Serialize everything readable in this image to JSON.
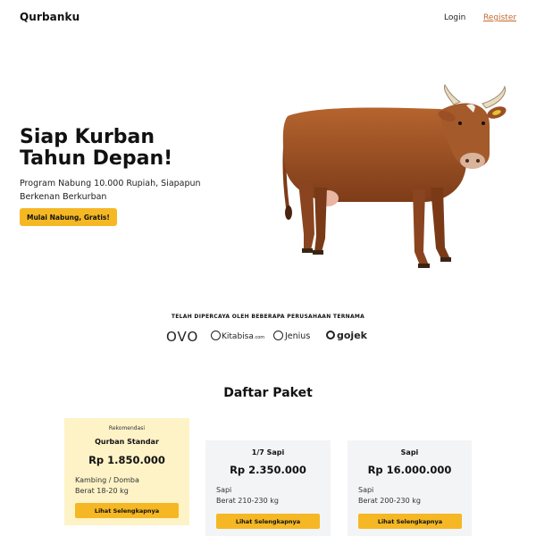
{
  "nav": {
    "brand": "Qurbanku",
    "login": "Login",
    "register": "Register"
  },
  "hero": {
    "title_line1": "Siap Kurban",
    "title_line2": "Tahun Depan!",
    "subtitle": "Program Nabung 10.000 Rupiah, Siapapun Berkenan Berkurban",
    "cta": "Mulai Nabung, Gratis!",
    "image": "cow-photo"
  },
  "partners": {
    "heading": "TELAH DIPERCAYA OLEH BEBERAPA PERUSAHAAN TERNAMA",
    "logos": [
      {
        "name": "OVO",
        "text": "OVO"
      },
      {
        "name": "Kitabisa",
        "text": "Kitabisa",
        "suffix": ".com"
      },
      {
        "name": "Jenius",
        "text": "Jenius"
      },
      {
        "name": "Gojek",
        "text": "gojek"
      }
    ]
  },
  "packages": {
    "title": "Daftar Paket",
    "items": [
      {
        "badge": "Rekomendasi",
        "name": "Qurban Standar",
        "price": "Rp 1.850.000",
        "type": "Kambing / Domba",
        "weight": "Berat 18-20 kg",
        "button": "Lihat Selengkapnya",
        "featured": true
      },
      {
        "name": "1/7 Sapi",
        "price": "Rp 2.350.000",
        "type": "Sapi",
        "weight": "Berat 210-230 kg",
        "button": "Lihat Selengkapnya",
        "featured": false
      },
      {
        "name": "Sapi",
        "price": "Rp 16.000.000",
        "type": "Sapi",
        "weight": "Berat 200-230 kg",
        "button": "Lihat Selengkapnya",
        "featured": false
      }
    ]
  },
  "colors": {
    "accent": "#f5b824",
    "featured_card": "#fef3c7",
    "card": "#f3f4f6",
    "register_link": "#c36a2d",
    "cow": "#9a4f24"
  }
}
